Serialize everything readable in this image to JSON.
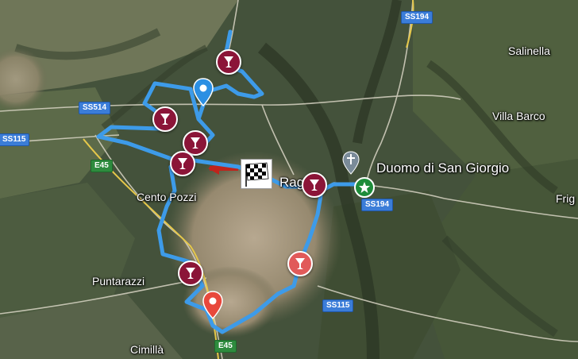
{
  "map": {
    "places": {
      "salinella": "Salinella",
      "villa_barco": "Villa Barco",
      "frig": "Frig",
      "duomo": "Duomo di San Giorgio",
      "rag": "Rag",
      "cento_pozzi": "Cento Pozzi",
      "puntarazzi": "Puntarazzi",
      "cimilla": "Cimillà"
    },
    "roads": {
      "ss194_top": "SS194",
      "ss514": "SS514",
      "ss115_left": "SS115",
      "e45_left": "E45",
      "ss194_mid": "SS194",
      "ss115_bottom": "SS115",
      "e45_bottom": "E45"
    },
    "colors": {
      "route": "#3d9be9",
      "wine_dark": "#8b1538",
      "wine_light": "#e15a5a",
      "pin_blue": "#2b8fe3",
      "pin_red": "#e8483c",
      "road_shield": "#3b7dd8",
      "euro_shield": "#2e8b3e",
      "start_arrow": "#c0241c",
      "star_green": "#1e8c3a"
    },
    "markers": {
      "wine_stops": [
        "wine-glass-icon",
        "wine-glass-icon",
        "wine-glass-icon",
        "wine-glass-icon",
        "wine-glass-icon",
        "wine-glass-icon",
        "wine-glass-icon"
      ],
      "start": "checkered-flag-icon",
      "landmark": "church-cross-icon",
      "favorite": "star-icon"
    }
  }
}
